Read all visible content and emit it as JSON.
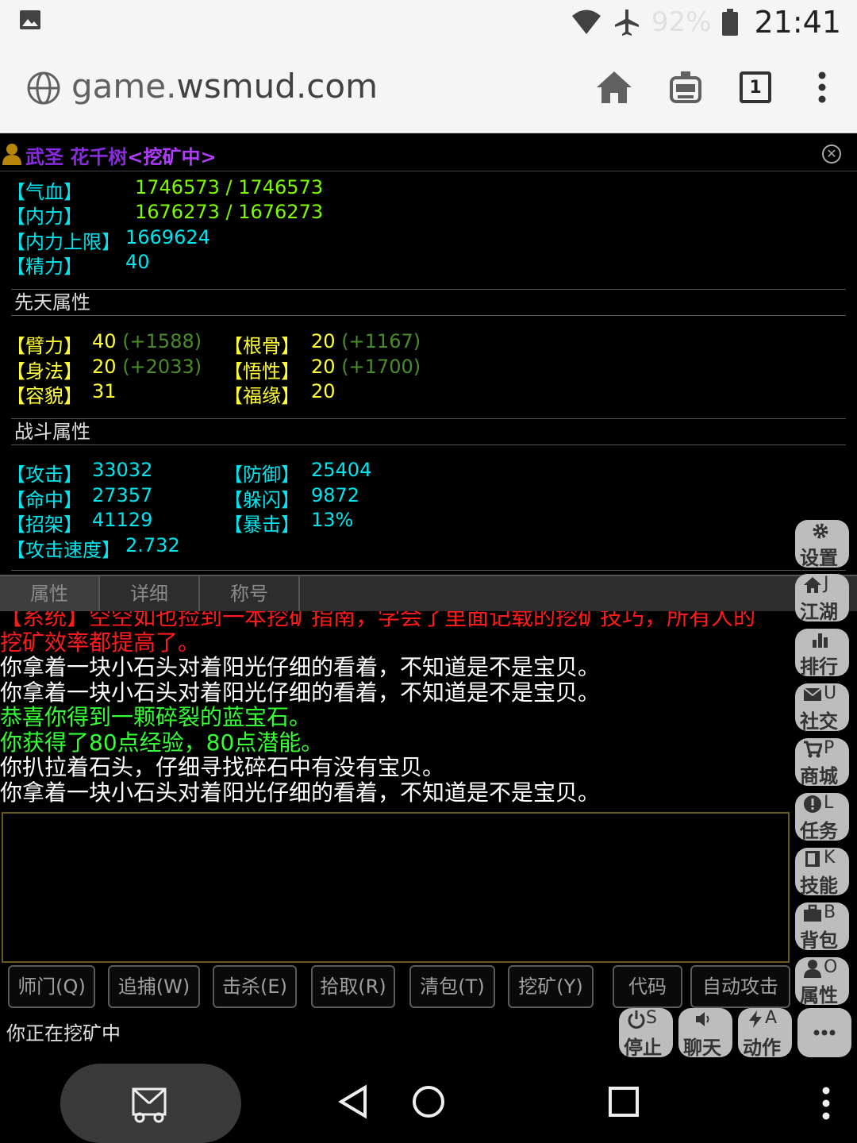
{
  "statusbar": {
    "battery_pct": "92%",
    "clock": "21:41",
    "icons": [
      "gallery-icon",
      "wifi-icon",
      "airplane-icon",
      "battery-icon"
    ]
  },
  "browser": {
    "url_host": "game.",
    "url_domain": "wsmud.com",
    "tab_count": "1",
    "icons": [
      "globe-icon",
      "home-icon",
      "bot-icon",
      "tabs-icon",
      "more-vert-icon"
    ]
  },
  "title": {
    "rank": "武圣",
    "name": "花千树",
    "status": "<挖矿中>"
  },
  "vitals": [
    {
      "label": "【气血】",
      "value": "1746573 / 1746573"
    },
    {
      "label": "【内力】",
      "value": "1676273 / 1676273"
    },
    {
      "label": "【内力上限】",
      "value": "1669624"
    },
    {
      "label": "【精力】",
      "value": "40"
    }
  ],
  "innate": {
    "header": "先天属性",
    "left": [
      {
        "label": "【臂力】",
        "value": "40",
        "bonus": "(+1588)"
      },
      {
        "label": "【身法】",
        "value": "20",
        "bonus": "(+2033)"
      },
      {
        "label": "【容貌】",
        "value": "31",
        "bonus": ""
      }
    ],
    "right": [
      {
        "label": "【根骨】",
        "value": "20",
        "bonus": "(+1167)"
      },
      {
        "label": "【悟性】",
        "value": "20",
        "bonus": "(+1700)"
      },
      {
        "label": "【福缘】",
        "value": "20",
        "bonus": ""
      }
    ]
  },
  "combat": {
    "header": "战斗属性",
    "left": [
      {
        "label": "【攻击】",
        "value": "33032"
      },
      {
        "label": "【命中】",
        "value": "27357"
      },
      {
        "label": "【招架】",
        "value": "41129"
      }
    ],
    "right": [
      {
        "label": "【防御】",
        "value": "25404"
      },
      {
        "label": "【躲闪】",
        "value": "9872"
      },
      {
        "label": "【暴击】",
        "value": "13%"
      }
    ],
    "speed": {
      "label": "【攻击速度】",
      "value": "2.732"
    }
  },
  "tabs": [
    "属性",
    "详细",
    "称号"
  ],
  "log": [
    {
      "color": "red",
      "text": "【系统】空空如也捡到一本挖矿指南，学会了里面记载的挖矿技巧，所有人的"
    },
    {
      "color": "red",
      "text": "挖矿效率都提高了。"
    },
    {
      "color": "white",
      "text": "你拿着一块小石头对着阳光仔细的看着，不知道是不是宝贝。"
    },
    {
      "color": "white",
      "text": "你拿着一块小石头对着阳光仔细的看着，不知道是不是宝贝。"
    },
    {
      "color": "green",
      "text": "恭喜你得到一颗碎裂的蓝宝石。"
    },
    {
      "color": "green",
      "text": "你获得了80点经验，80点潜能。"
    },
    {
      "color": "white",
      "text": "你扒拉着石头，仔细寻找碎石中有没有宝贝。"
    },
    {
      "color": "white",
      "text": "你拿着一块小石头对着阳光仔细的看着，不知道是不是宝贝。"
    }
  ],
  "actions": [
    "师门(Q)",
    "追捕(W)",
    "击杀(E)",
    "拾取(R)",
    "清包(T)",
    "挖矿(Y)",
    "代码",
    "自动攻击"
  ],
  "mining_status": "你正在挖矿中",
  "side_buttons": [
    {
      "key": "",
      "label": "设置",
      "icon": "gear-icon"
    },
    {
      "key": "J",
      "label": "江湖",
      "icon": "home-icon"
    },
    {
      "key": "",
      "label": "排行",
      "icon": "bar-chart-icon"
    },
    {
      "key": "U",
      "label": "社交",
      "icon": "mail-icon"
    },
    {
      "key": "P",
      "label": "商城",
      "icon": "cart-icon"
    },
    {
      "key": "L",
      "label": "任务",
      "icon": "alert-icon"
    },
    {
      "key": "K",
      "label": "技能",
      "icon": "book-icon"
    },
    {
      "key": "B",
      "label": "背包",
      "icon": "briefcase-icon"
    },
    {
      "key": "O",
      "label": "属性",
      "icon": "user-icon"
    }
  ],
  "bottom_buttons": [
    {
      "key": "S",
      "label": "停止",
      "icon": "power-icon"
    },
    {
      "key": "",
      "label": "聊天",
      "icon": "speaker-icon"
    },
    {
      "key": "A",
      "label": "动作",
      "icon": "bolt-icon"
    },
    {
      "key": "",
      "label": "",
      "icon": "ellipsis-icon"
    }
  ],
  "navbar": {
    "icons": [
      "screen-mirror-icon",
      "back-icon",
      "home-circle-icon",
      "recents-icon",
      "more-vert-icon"
    ]
  }
}
